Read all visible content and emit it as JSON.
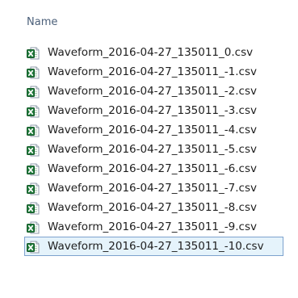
{
  "header": {
    "name_column": "Name"
  },
  "icons": {
    "file_icon": "excel-csv-file-icon"
  },
  "colors": {
    "selection_fill": "#e5f3fb",
    "selection_border": "#7da2ce",
    "excel_green": "#1f7a3a"
  },
  "files": [
    {
      "name": "Waveform_2016-04-27_135011_0.csv",
      "selected": false
    },
    {
      "name": "Waveform_2016-04-27_135011_-1.csv",
      "selected": false
    },
    {
      "name": "Waveform_2016-04-27_135011_-2.csv",
      "selected": false
    },
    {
      "name": "Waveform_2016-04-27_135011_-3.csv",
      "selected": false
    },
    {
      "name": "Waveform_2016-04-27_135011_-4.csv",
      "selected": false
    },
    {
      "name": "Waveform_2016-04-27_135011_-5.csv",
      "selected": false
    },
    {
      "name": "Waveform_2016-04-27_135011_-6.csv",
      "selected": false
    },
    {
      "name": "Waveform_2016-04-27_135011_-7.csv",
      "selected": false
    },
    {
      "name": "Waveform_2016-04-27_135011_-8.csv",
      "selected": false
    },
    {
      "name": "Waveform_2016-04-27_135011_-9.csv",
      "selected": false
    },
    {
      "name": "Waveform_2016-04-27_135011_-10.csv",
      "selected": true
    }
  ]
}
